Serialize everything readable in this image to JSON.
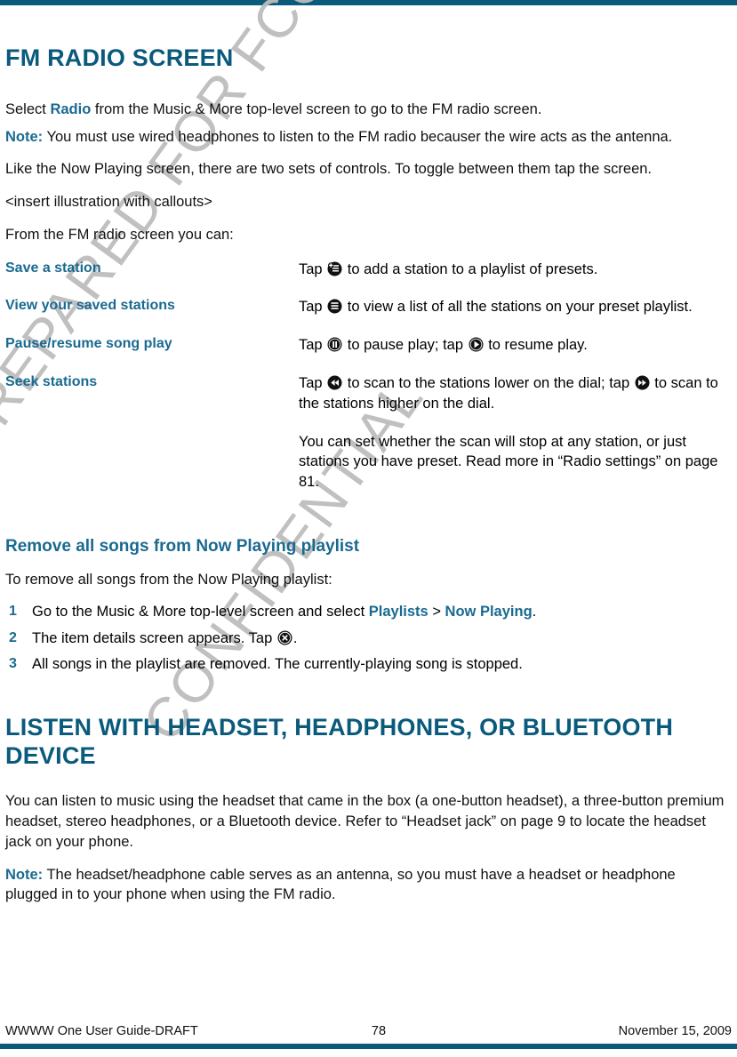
{
  "page": {
    "accent_color": "#0a5a7c",
    "heading_color": "#1a6a90",
    "watermark_line1": "PREPARED FOR FCC CERTIFICATION",
    "watermark_line2": "CONFIDENTIAL"
  },
  "headings": {
    "chapter1": "FM RADIO SCREEN",
    "section1": "Remove all songs from Now Playing playlist",
    "chapter2": "LISTEN WITH HEADSET, HEADPHONES, OR BLUETOOTH DEVICE"
  },
  "intro": {
    "p1_before": "Select ",
    "p1_keyword": "Radio",
    "p1_after": " from the Music & More top-level screen to go to the FM radio screen.",
    "note_label": "Note:",
    "note_text": " You must use wired headphones to listen to the FM radio becauser the wire acts as the antenna.",
    "p2": "Like the Now Playing screen, there are two sets of controls. To toggle between them tap the screen.",
    "p3": "<insert illustration with callouts>",
    "p4": "From the FM radio screen you can:"
  },
  "deflist": [
    {
      "term": "Save a station",
      "before": "Tap ",
      "icon": "save-station-icon",
      "after": " to add a station to a playlist of presets."
    },
    {
      "term": "View your saved stations",
      "before": "Tap ",
      "icon": "view-stations-icon",
      "after": " to view a list of all the stations on your preset playlist."
    },
    {
      "term": "Pause/resume song play",
      "before": "Tap ",
      "icon": "pause-icon",
      "middle": " to pause play; tap ",
      "icon2": "play-icon",
      "after": " to resume play."
    },
    {
      "term": "Seek stations",
      "before": "Tap ",
      "icon": "rewind-icon",
      "middle": " to scan to the stations lower on the dial; tap ",
      "icon2": "fast-forward-icon",
      "after": " to scan to the stations higher on the dial.",
      "extra": "You can set whether the scan will stop at any station, or just stations you have preset. Read more in “Radio settings” on page 81."
    }
  ],
  "remove_section": {
    "lead": "To remove all songs from the Now Playing playlist:",
    "steps": [
      {
        "num": "1",
        "before": "Go to the Music & More top-level screen and select ",
        "kw1": "Playlists",
        "sep": " > ",
        "kw2": "Now Playing",
        "after": "."
      },
      {
        "num": "2",
        "before": "The item details screen appears. Tap ",
        "icon": "clear-playlist-icon",
        "after": "."
      },
      {
        "num": "3",
        "text": "All songs in the playlist are removed. The currently-playing song is stopped."
      }
    ]
  },
  "listen_section": {
    "p1": "You can listen to music using the headset that came in the box (a one-button headset), a three-button premium headset, stereo headphones, or a Bluetooth device. Refer to “Headset jack” on page 9 to locate the headset jack on your phone.",
    "note_label": "Note:",
    "note_text": " The headset/headphone cable serves as an antenna, so you must have a headset or headphone plugged in to your phone when using the FM radio."
  },
  "footer": {
    "left": "WWWW One User Guide-DRAFT",
    "center": "78",
    "right": "November 15, 2009"
  }
}
